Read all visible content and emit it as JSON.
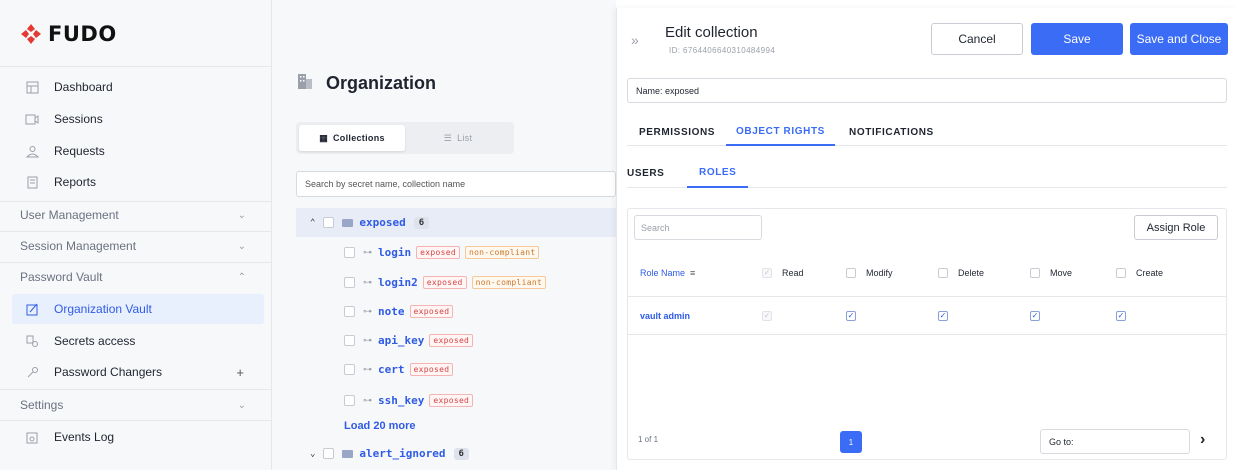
{
  "brand": {
    "name": "FUDO",
    "color": "#e53935"
  },
  "sidebar": {
    "items": [
      {
        "label": "Dashboard",
        "icon": "dashboard-icon"
      },
      {
        "label": "Sessions",
        "icon": "sessions-icon"
      },
      {
        "label": "Requests",
        "icon": "requests-icon"
      },
      {
        "label": "Reports",
        "icon": "reports-icon"
      }
    ],
    "groups": [
      {
        "label": "User Management",
        "expanded": false
      },
      {
        "label": "Session Management",
        "expanded": false
      },
      {
        "label": "Password Vault",
        "expanded": true
      }
    ],
    "vault_items": [
      {
        "label": "Organization Vault",
        "icon": "vault-icon",
        "active": true
      },
      {
        "label": "Secrets access",
        "icon": "secrets-access-icon"
      },
      {
        "label": "Password Changers",
        "icon": "password-changers-icon",
        "action": "+"
      }
    ],
    "settings": {
      "label": "Settings",
      "expanded": false
    },
    "events_log": {
      "label": "Events Log",
      "icon": "events-log-icon"
    }
  },
  "main": {
    "title": "Organization",
    "view_toggle": {
      "collections": "Collections",
      "list": "List",
      "selected": "Collections"
    },
    "search_placeholder": "Search by secret name, collection name",
    "tree": {
      "collections": [
        {
          "name": "exposed",
          "count": "6",
          "expanded": true,
          "secrets": [
            {
              "name": "login",
              "tags": [
                "exposed",
                "non-compliant"
              ]
            },
            {
              "name": "login2",
              "tags": [
                "exposed",
                "non-compliant"
              ]
            },
            {
              "name": "note",
              "tags": [
                "exposed"
              ]
            },
            {
              "name": "api_key",
              "tags": [
                "exposed"
              ]
            },
            {
              "name": "cert",
              "tags": [
                "exposed"
              ]
            },
            {
              "name": "ssh_key",
              "tags": [
                "exposed"
              ]
            }
          ]
        },
        {
          "name": "alert_ignored",
          "count": "6",
          "expanded": false,
          "secrets": []
        }
      ],
      "load_more": "Load 20 more"
    }
  },
  "panel": {
    "title": "Edit collection",
    "id_text": "ID: 6764406640310484994",
    "buttons": {
      "cancel": "Cancel",
      "save": "Save",
      "save_close": "Save and Close"
    },
    "name_field": "Name: exposed",
    "tabs": [
      "PERMISSIONS",
      "OBJECT RIGHTS",
      "NOTIFICATIONS"
    ],
    "active_tab": "OBJECT RIGHTS",
    "subtabs": [
      "USERS",
      "ROLES"
    ],
    "active_subtab": "ROLES",
    "grid": {
      "search_placeholder": "Search",
      "assign_button": "Assign Role",
      "columns": {
        "name": "Role Name",
        "perms": [
          "Read",
          "Modify",
          "Delete",
          "Move",
          "Create"
        ]
      },
      "rows": [
        {
          "name": "vault admin",
          "read": true,
          "modify": true,
          "delete": true,
          "move": true,
          "create": true,
          "read_disabled": true
        }
      ],
      "pagination": {
        "info": "1 of 1",
        "current": "1",
        "goto_label": "Go to:"
      }
    }
  }
}
